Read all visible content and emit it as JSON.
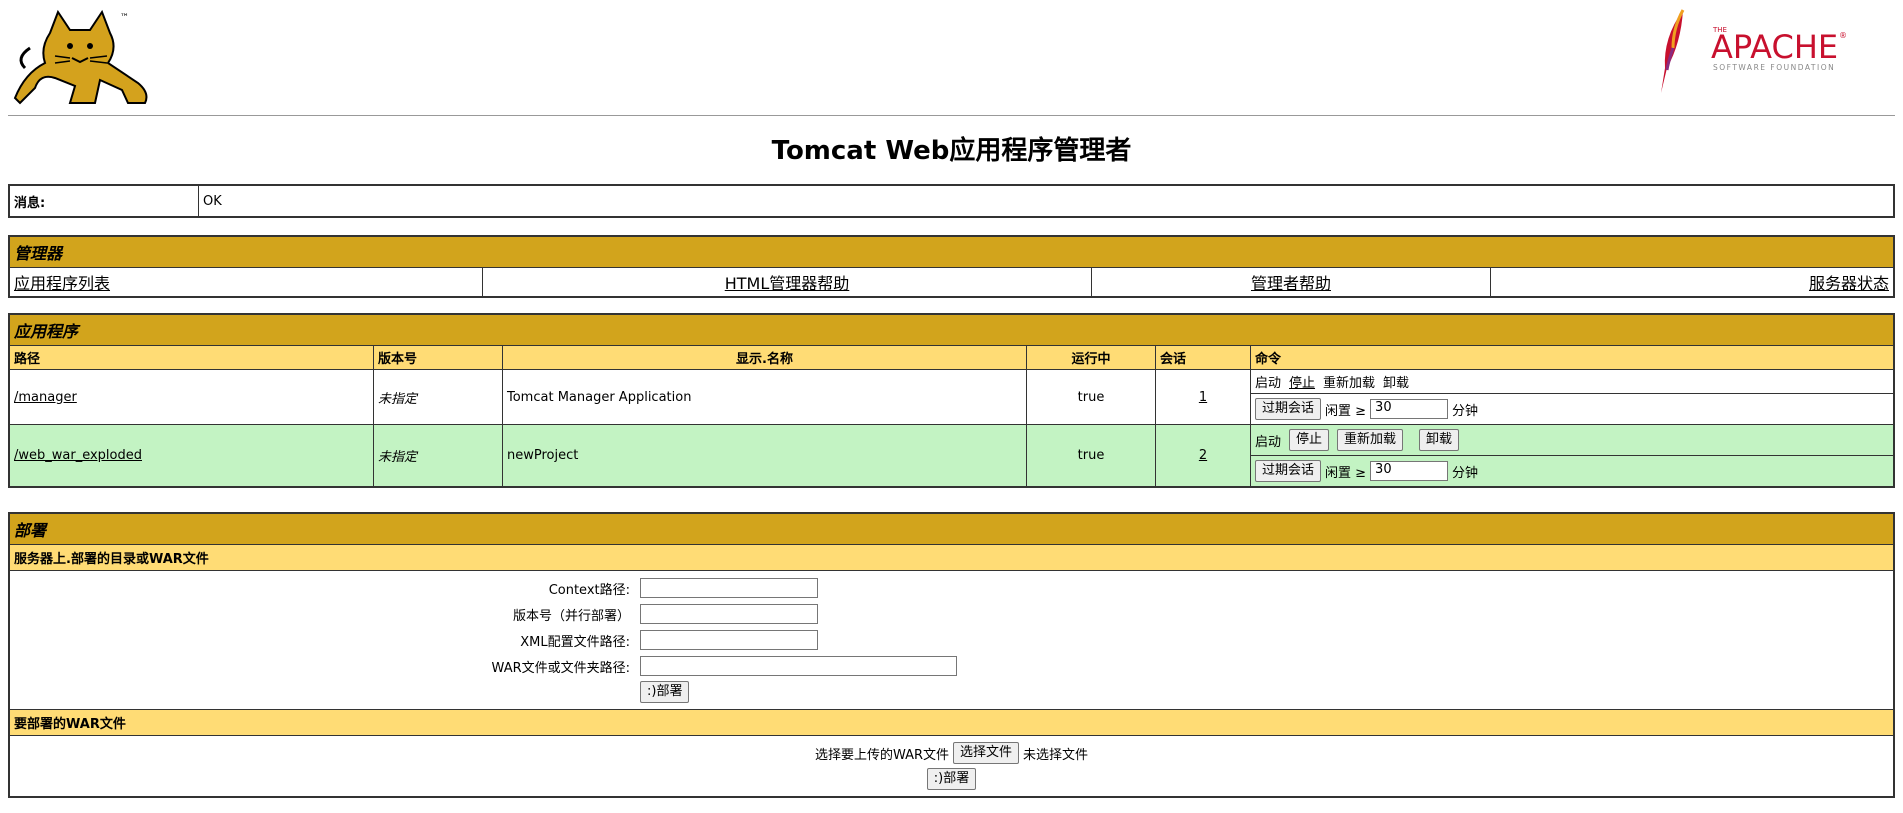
{
  "title": "Tomcat Web应用程序管理者",
  "logos": {
    "tomcat_tm": "™",
    "apache_the": "THE",
    "apache_name": "APACHE",
    "apache_reg": "®",
    "apache_sub": "SOFTWARE FOUNDATION"
  },
  "message": {
    "label": "消息:",
    "value": "OK"
  },
  "manager": {
    "section_title": "管理器",
    "links": [
      "应用程序列表",
      "HTML管理器帮助",
      "管理者帮助",
      "服务器状态"
    ]
  },
  "applications": {
    "section_title": "应用程序",
    "columns": [
      "路径",
      "版本号",
      "显示.名称",
      "运行中",
      "会话",
      "命令"
    ],
    "rows": [
      {
        "path": "/manager",
        "version": "未指定",
        "display_name": "Tomcat Manager Application",
        "running": "true",
        "sessions": "1",
        "cmd_start": "启动",
        "cmd_stop": "停止",
        "cmd_reload": "重新加载",
        "cmd_undeploy": "卸载",
        "expire_button": "过期会话",
        "idle_label": "闲置 ≥",
        "idle_value": "30",
        "idle_unit": "分钟"
      },
      {
        "path": "/web_war_exploded",
        "version": "未指定",
        "display_name": "newProject",
        "running": "true",
        "sessions": "2",
        "cmd_start": "启动",
        "cmd_stop": "停止",
        "cmd_reload": "重新加载",
        "cmd_undeploy": "卸载",
        "expire_button": "过期会话",
        "idle_label": "闲置 ≥",
        "idle_value": "30",
        "idle_unit": "分钟"
      }
    ]
  },
  "deploy": {
    "section_title": "部署",
    "server_title": "服务器上.部署的目录或WAR文件",
    "context_label": "Context路径:",
    "version_label": "版本号（并行部署）",
    "xml_label": "XML配置文件路径:",
    "war_label": "WAR文件或文件夹路径:",
    "deploy_button": ":)部署",
    "upload_title": "要部署的WAR文件",
    "choose_label": "选择要上传的WAR文件",
    "choose_button": "选择文件",
    "no_file": "未选择文件",
    "upload_button": ":)部署"
  },
  "colors": {
    "section": "#d2a41c",
    "subheader": "#ffdc75",
    "green_row": "#c3f3c3"
  }
}
